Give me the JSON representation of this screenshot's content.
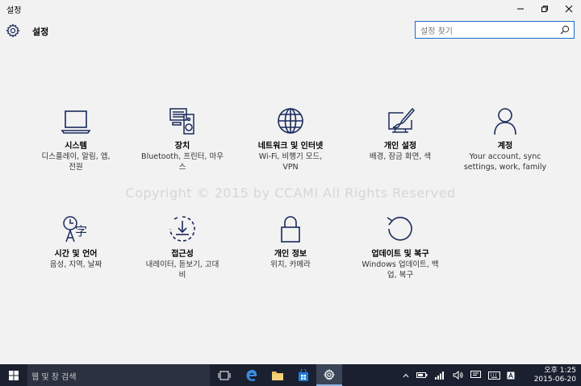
{
  "window": {
    "title": "설정"
  },
  "header": {
    "title": "설정",
    "search_placeholder": "설정 찾기"
  },
  "watermark": "Copyright © 2015 by CCAMI All Rights Reserved",
  "categories": [
    {
      "icon": "laptop-icon",
      "name": "시스템",
      "desc1": "디스플레이, 알림, 앱,",
      "desc2": "전원"
    },
    {
      "icon": "devices-icon",
      "name": "장치",
      "desc1": "Bluetooth, 프린터, 마우",
      "desc2": "스"
    },
    {
      "icon": "globe-icon",
      "name": "네트워크 및 인터넷",
      "desc1": "Wi-Fi, 비행기 모드,",
      "desc2": "VPN"
    },
    {
      "icon": "personalization-icon",
      "name": "개인 설정",
      "desc1": "배경, 잠금 화면, 색",
      "desc2": ""
    },
    {
      "icon": "person-icon",
      "name": "계정",
      "desc1": "Your account, sync",
      "desc2": "settings, work, family"
    },
    {
      "icon": "time-language-icon",
      "name": "시간 및 언어",
      "desc1": "음성, 지역, 날짜",
      "desc2": ""
    },
    {
      "icon": "ease-of-access-icon",
      "name": "접근성",
      "desc1": "내레이터, 돋보기, 고대",
      "desc2": "비"
    },
    {
      "icon": "lock-icon",
      "name": "개인 정보",
      "desc1": "위치, 카메라",
      "desc2": ""
    },
    {
      "icon": "update-icon",
      "name": "업데이트 및 복구",
      "desc1": "Windows 업데이트, 백",
      "desc2": "업, 복구"
    }
  ],
  "taskbar": {
    "search_text": "웹 및 창 검색",
    "time": "오후 1:25",
    "date": "2015-06-20"
  },
  "colors": {
    "accent": "#1a2a5c",
    "taskbar": "#1b2030",
    "background": "#f2f2f2"
  }
}
